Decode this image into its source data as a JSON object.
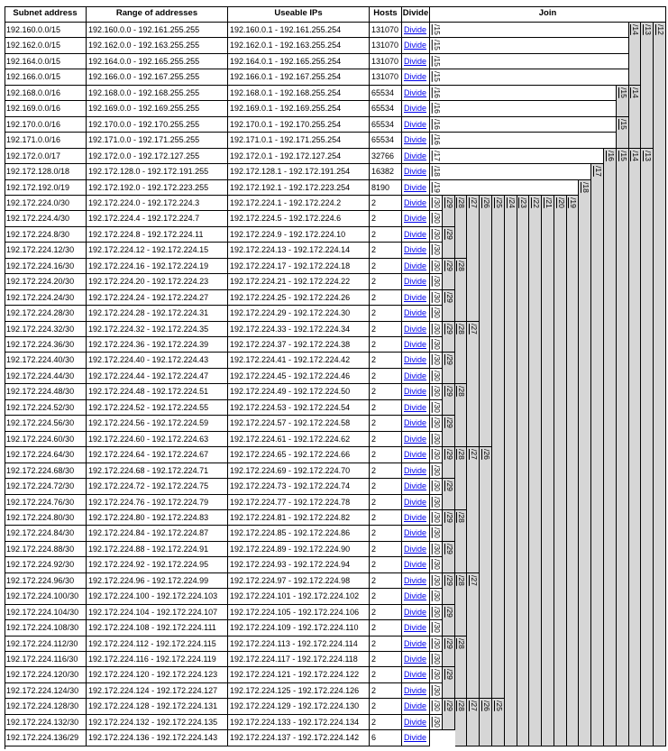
{
  "headers": {
    "subnet": "Subnet address",
    "range": "Range of addresses",
    "useable": "Useable IPs",
    "hosts": "Hosts",
    "divide": "Divide",
    "join": "Join"
  },
  "divide_label": "Divide",
  "rows": [
    {
      "subnet": "192.160.0.0/15",
      "range": "192.160.0.0 - 192.161.255.255",
      "useable": "192.160.0.1 - 192.161.255.254",
      "hosts": "131070"
    },
    {
      "subnet": "192.162.0.0/15",
      "range": "192.162.0.0 - 192.163.255.255",
      "useable": "192.162.0.1 - 192.163.255.254",
      "hosts": "131070"
    },
    {
      "subnet": "192.164.0.0/15",
      "range": "192.164.0.0 - 192.165.255.255",
      "useable": "192.164.0.1 - 192.165.255.254",
      "hosts": "131070"
    },
    {
      "subnet": "192.166.0.0/15",
      "range": "192.166.0.0 - 192.167.255.255",
      "useable": "192.166.0.1 - 192.167.255.254",
      "hosts": "131070"
    },
    {
      "subnet": "192.168.0.0/16",
      "range": "192.168.0.0 - 192.168.255.255",
      "useable": "192.168.0.1 - 192.168.255.254",
      "hosts": "65534"
    },
    {
      "subnet": "192.169.0.0/16",
      "range": "192.169.0.0 - 192.169.255.255",
      "useable": "192.169.0.1 - 192.169.255.254",
      "hosts": "65534"
    },
    {
      "subnet": "192.170.0.0/16",
      "range": "192.170.0.0 - 192.170.255.255",
      "useable": "192.170.0.1 - 192.170.255.254",
      "hosts": "65534"
    },
    {
      "subnet": "192.171.0.0/16",
      "range": "192.171.0.0 - 192.171.255.255",
      "useable": "192.171.0.1 - 192.171.255.254",
      "hosts": "65534"
    },
    {
      "subnet": "192.172.0.0/17",
      "range": "192.172.0.0 - 192.172.127.255",
      "useable": "192.172.0.1 - 192.172.127.254",
      "hosts": "32766"
    },
    {
      "subnet": "192.172.128.0/18",
      "range": "192.172.128.0 - 192.172.191.255",
      "useable": "192.172.128.1 - 192.172.191.254",
      "hosts": "16382"
    },
    {
      "subnet": "192.172.192.0/19",
      "range": "192.172.192.0 - 192.172.223.255",
      "useable": "192.172.192.1 - 192.172.223.254",
      "hosts": "8190"
    },
    {
      "subnet": "192.172.224.0/30",
      "range": "192.172.224.0 - 192.172.224.3",
      "useable": "192.172.224.1 - 192.172.224.2",
      "hosts": "2"
    },
    {
      "subnet": "192.172.224.4/30",
      "range": "192.172.224.4 - 192.172.224.7",
      "useable": "192.172.224.5 - 192.172.224.6",
      "hosts": "2"
    },
    {
      "subnet": "192.172.224.8/30",
      "range": "192.172.224.8 - 192.172.224.11",
      "useable": "192.172.224.9 - 192.172.224.10",
      "hosts": "2"
    },
    {
      "subnet": "192.172.224.12/30",
      "range": "192.172.224.12 - 192.172.224.15",
      "useable": "192.172.224.13 - 192.172.224.14",
      "hosts": "2"
    },
    {
      "subnet": "192.172.224.16/30",
      "range": "192.172.224.16 - 192.172.224.19",
      "useable": "192.172.224.17 - 192.172.224.18",
      "hosts": "2"
    },
    {
      "subnet": "192.172.224.20/30",
      "range": "192.172.224.20 - 192.172.224.23",
      "useable": "192.172.224.21 - 192.172.224.22",
      "hosts": "2"
    },
    {
      "subnet": "192.172.224.24/30",
      "range": "192.172.224.24 - 192.172.224.27",
      "useable": "192.172.224.25 - 192.172.224.26",
      "hosts": "2"
    },
    {
      "subnet": "192.172.224.28/30",
      "range": "192.172.224.28 - 192.172.224.31",
      "useable": "192.172.224.29 - 192.172.224.30",
      "hosts": "2"
    },
    {
      "subnet": "192.172.224.32/30",
      "range": "192.172.224.32 - 192.172.224.35",
      "useable": "192.172.224.33 - 192.172.224.34",
      "hosts": "2"
    },
    {
      "subnet": "192.172.224.36/30",
      "range": "192.172.224.36 - 192.172.224.39",
      "useable": "192.172.224.37 - 192.172.224.38",
      "hosts": "2"
    },
    {
      "subnet": "192.172.224.40/30",
      "range": "192.172.224.40 - 192.172.224.43",
      "useable": "192.172.224.41 - 192.172.224.42",
      "hosts": "2"
    },
    {
      "subnet": "192.172.224.44/30",
      "range": "192.172.224.44 - 192.172.224.47",
      "useable": "192.172.224.45 - 192.172.224.46",
      "hosts": "2"
    },
    {
      "subnet": "192.172.224.48/30",
      "range": "192.172.224.48 - 192.172.224.51",
      "useable": "192.172.224.49 - 192.172.224.50",
      "hosts": "2"
    },
    {
      "subnet": "192.172.224.52/30",
      "range": "192.172.224.52 - 192.172.224.55",
      "useable": "192.172.224.53 - 192.172.224.54",
      "hosts": "2"
    },
    {
      "subnet": "192.172.224.56/30",
      "range": "192.172.224.56 - 192.172.224.59",
      "useable": "192.172.224.57 - 192.172.224.58",
      "hosts": "2"
    },
    {
      "subnet": "192.172.224.60/30",
      "range": "192.172.224.60 - 192.172.224.63",
      "useable": "192.172.224.61 - 192.172.224.62",
      "hosts": "2"
    },
    {
      "subnet": "192.172.224.64/30",
      "range": "192.172.224.64 - 192.172.224.67",
      "useable": "192.172.224.65 - 192.172.224.66",
      "hosts": "2"
    },
    {
      "subnet": "192.172.224.68/30",
      "range": "192.172.224.68 - 192.172.224.71",
      "useable": "192.172.224.69 - 192.172.224.70",
      "hosts": "2"
    },
    {
      "subnet": "192.172.224.72/30",
      "range": "192.172.224.72 - 192.172.224.75",
      "useable": "192.172.224.73 - 192.172.224.74",
      "hosts": "2"
    },
    {
      "subnet": "192.172.224.76/30",
      "range": "192.172.224.76 - 192.172.224.79",
      "useable": "192.172.224.77 - 192.172.224.78",
      "hosts": "2"
    },
    {
      "subnet": "192.172.224.80/30",
      "range": "192.172.224.80 - 192.172.224.83",
      "useable": "192.172.224.81 - 192.172.224.82",
      "hosts": "2"
    },
    {
      "subnet": "192.172.224.84/30",
      "range": "192.172.224.84 - 192.172.224.87",
      "useable": "192.172.224.85 - 192.172.224.86",
      "hosts": "2"
    },
    {
      "subnet": "192.172.224.88/30",
      "range": "192.172.224.88 - 192.172.224.91",
      "useable": "192.172.224.89 - 192.172.224.90",
      "hosts": "2"
    },
    {
      "subnet": "192.172.224.92/30",
      "range": "192.172.224.92 - 192.172.224.95",
      "useable": "192.172.224.93 - 192.172.224.94",
      "hosts": "2"
    },
    {
      "subnet": "192.172.224.96/30",
      "range": "192.172.224.96 - 192.172.224.99",
      "useable": "192.172.224.97 - 192.172.224.98",
      "hosts": "2"
    },
    {
      "subnet": "192.172.224.100/30",
      "range": "192.172.224.100 - 192.172.224.103",
      "useable": "192.172.224.101 - 192.172.224.102",
      "hosts": "2"
    },
    {
      "subnet": "192.172.224.104/30",
      "range": "192.172.224.104 - 192.172.224.107",
      "useable": "192.172.224.105 - 192.172.224.106",
      "hosts": "2"
    },
    {
      "subnet": "192.172.224.108/30",
      "range": "192.172.224.108 - 192.172.224.111",
      "useable": "192.172.224.109 - 192.172.224.110",
      "hosts": "2"
    },
    {
      "subnet": "192.172.224.112/30",
      "range": "192.172.224.112 - 192.172.224.115",
      "useable": "192.172.224.113 - 192.172.224.114",
      "hosts": "2"
    },
    {
      "subnet": "192.172.224.116/30",
      "range": "192.172.224.116 - 192.172.224.119",
      "useable": "192.172.224.117 - 192.172.224.118",
      "hosts": "2"
    },
    {
      "subnet": "192.172.224.120/30",
      "range": "192.172.224.120 - 192.172.224.123",
      "useable": "192.172.224.121 - 192.172.224.122",
      "hosts": "2"
    },
    {
      "subnet": "192.172.224.124/30",
      "range": "192.172.224.124 - 192.172.224.127",
      "useable": "192.172.224.125 - 192.172.224.126",
      "hosts": "2"
    },
    {
      "subnet": "192.172.224.128/30",
      "range": "192.172.224.128 - 192.172.224.131",
      "useable": "192.172.224.129 - 192.172.224.130",
      "hosts": "2"
    },
    {
      "subnet": "192.172.224.132/30",
      "range": "192.172.224.132 - 192.172.224.135",
      "useable": "192.172.224.133 - 192.172.224.134",
      "hosts": "2"
    },
    {
      "subnet": "192.172.224.136/29",
      "range": "192.172.224.136 - 192.172.224.143",
      "useable": "192.172.224.137 - 192.172.224.142",
      "hosts": "6"
    }
  ],
  "join_blocks": [
    {
      "label": "/12",
      "rows": [
        0,
        45
      ]
    },
    {
      "label": "/13",
      "rows": [
        0,
        7
      ]
    },
    {
      "label": "/14",
      "rows": [
        0,
        3
      ]
    },
    {
      "label": "/15",
      "rows": [
        0,
        0
      ]
    },
    {
      "label": "/15",
      "rows": [
        1,
        1
      ]
    },
    {
      "label": "/15",
      "rows": [
        2,
        2
      ]
    },
    {
      "label": "/15",
      "rows": [
        3,
        3
      ]
    },
    {
      "label": "/14",
      "rows": [
        4,
        7
      ]
    },
    {
      "label": "/15",
      "rows": [
        4,
        5
      ]
    },
    {
      "label": "/15",
      "rows": [
        6,
        7
      ]
    },
    {
      "label": "/16",
      "rows": [
        4,
        4
      ]
    },
    {
      "label": "/16",
      "rows": [
        5,
        5
      ]
    },
    {
      "label": "/16",
      "rows": [
        6,
        6
      ]
    },
    {
      "label": "/16",
      "rows": [
        7,
        7
      ]
    },
    {
      "label": "/13",
      "rows": [
        8,
        45
      ]
    },
    {
      "label": "/14",
      "rows": [
        8,
        45
      ]
    },
    {
      "label": "/15",
      "rows": [
        8,
        45
      ]
    },
    {
      "label": "/16",
      "rows": [
        8,
        45
      ]
    },
    {
      "label": "/17",
      "rows": [
        8,
        8
      ]
    },
    {
      "label": "/17",
      "rows": [
        9,
        45
      ]
    },
    {
      "label": "/18",
      "rows": [
        9,
        9
      ]
    },
    {
      "label": "/18",
      "rows": [
        10,
        45
      ]
    },
    {
      "label": "/19",
      "rows": [
        10,
        10
      ]
    },
    {
      "label": "/19",
      "rows": [
        11,
        45
      ]
    },
    {
      "label": "/20",
      "rows": [
        11,
        45
      ]
    },
    {
      "label": "/21",
      "rows": [
        11,
        45
      ]
    },
    {
      "label": "/22",
      "rows": [
        11,
        45
      ]
    },
    {
      "label": "/23",
      "rows": [
        11,
        45
      ]
    },
    {
      "label": "/24",
      "rows": [
        11,
        45
      ]
    },
    {
      "label": "/25",
      "rows": [
        11,
        42
      ]
    },
    {
      "label": "/25",
      "rows": [
        43,
        45
      ]
    },
    {
      "label": "/26",
      "rows": [
        11,
        26
      ]
    },
    {
      "label": "/26",
      "rows": [
        27,
        42
      ]
    },
    {
      "label": "/26",
      "rows": [
        43,
        45
      ]
    },
    {
      "label": "/27",
      "rows": [
        11,
        18
      ]
    },
    {
      "label": "/27",
      "rows": [
        19,
        26
      ]
    },
    {
      "label": "/27",
      "rows": [
        27,
        34
      ]
    },
    {
      "label": "/27",
      "rows": [
        35,
        42
      ]
    },
    {
      "label": "/27",
      "rows": [
        43,
        45
      ]
    },
    {
      "label": "/28",
      "rows": [
        11,
        14
      ]
    },
    {
      "label": "/28",
      "rows": [
        15,
        18
      ]
    },
    {
      "label": "/28",
      "rows": [
        19,
        22
      ]
    },
    {
      "label": "/28",
      "rows": [
        23,
        26
      ]
    },
    {
      "label": "/28",
      "rows": [
        27,
        30
      ]
    },
    {
      "label": "/28",
      "rows": [
        31,
        34
      ]
    },
    {
      "label": "/28",
      "rows": [
        35,
        38
      ]
    },
    {
      "label": "/28",
      "rows": [
        39,
        42
      ]
    },
    {
      "label": "/28",
      "rows": [
        43,
        45
      ]
    },
    {
      "label": "/29",
      "rows": [
        11,
        12
      ]
    },
    {
      "label": "/29",
      "rows": [
        13,
        14
      ]
    },
    {
      "label": "/29",
      "rows": [
        15,
        16
      ]
    },
    {
      "label": "/29",
      "rows": [
        17,
        18
      ]
    },
    {
      "label": "/29",
      "rows": [
        19,
        20
      ]
    },
    {
      "label": "/29",
      "rows": [
        21,
        22
      ]
    },
    {
      "label": "/29",
      "rows": [
        23,
        24
      ]
    },
    {
      "label": "/29",
      "rows": [
        25,
        26
      ]
    },
    {
      "label": "/29",
      "rows": [
        27,
        28
      ]
    },
    {
      "label": "/29",
      "rows": [
        29,
        30
      ]
    },
    {
      "label": "/29",
      "rows": [
        31,
        32
      ]
    },
    {
      "label": "/29",
      "rows": [
        33,
        34
      ]
    },
    {
      "label": "/29",
      "rows": [
        35,
        36
      ]
    },
    {
      "label": "/29",
      "rows": [
        37,
        38
      ]
    },
    {
      "label": "/29",
      "rows": [
        39,
        40
      ]
    },
    {
      "label": "/29",
      "rows": [
        41,
        42
      ]
    },
    {
      "label": "/29",
      "rows": [
        43,
        44
      ]
    },
    {
      "label": "/30",
      "rows": [
        11,
        11
      ]
    },
    {
      "label": "/30",
      "rows": [
        12,
        12
      ]
    },
    {
      "label": "/30",
      "rows": [
        13,
        13
      ]
    },
    {
      "label": "/30",
      "rows": [
        14,
        14
      ]
    },
    {
      "label": "/30",
      "rows": [
        15,
        15
      ]
    },
    {
      "label": "/30",
      "rows": [
        16,
        16
      ]
    },
    {
      "label": "/30",
      "rows": [
        17,
        17
      ]
    },
    {
      "label": "/30",
      "rows": [
        18,
        18
      ]
    },
    {
      "label": "/30",
      "rows": [
        19,
        19
      ]
    },
    {
      "label": "/30",
      "rows": [
        20,
        20
      ]
    },
    {
      "label": "/30",
      "rows": [
        21,
        21
      ]
    },
    {
      "label": "/30",
      "rows": [
        22,
        22
      ]
    },
    {
      "label": "/30",
      "rows": [
        23,
        23
      ]
    },
    {
      "label": "/30",
      "rows": [
        24,
        24
      ]
    },
    {
      "label": "/30",
      "rows": [
        25,
        25
      ]
    },
    {
      "label": "/30",
      "rows": [
        26,
        26
      ]
    },
    {
      "label": "/30",
      "rows": [
        27,
        27
      ]
    },
    {
      "label": "/30",
      "rows": [
        28,
        28
      ]
    },
    {
      "label": "/30",
      "rows": [
        29,
        29
      ]
    },
    {
      "label": "/30",
      "rows": [
        30,
        30
      ]
    },
    {
      "label": "/30",
      "rows": [
        31,
        31
      ]
    },
    {
      "label": "/30",
      "rows": [
        32,
        32
      ]
    },
    {
      "label": "/30",
      "rows": [
        33,
        33
      ]
    },
    {
      "label": "/30",
      "rows": [
        34,
        34
      ]
    },
    {
      "label": "/30",
      "rows": [
        35,
        35
      ]
    },
    {
      "label": "/30",
      "rows": [
        36,
        36
      ]
    },
    {
      "label": "/30",
      "rows": [
        37,
        37
      ]
    },
    {
      "label": "/30",
      "rows": [
        38,
        38
      ]
    },
    {
      "label": "/30",
      "rows": [
        39,
        39
      ]
    },
    {
      "label": "/30",
      "rows": [
        40,
        40
      ]
    },
    {
      "label": "/30",
      "rows": [
        41,
        41
      ]
    },
    {
      "label": "/30",
      "rows": [
        42,
        42
      ]
    },
    {
      "label": "/30",
      "rows": [
        43,
        43
      ]
    },
    {
      "label": "/30",
      "rows": [
        44,
        44
      ]
    }
  ]
}
